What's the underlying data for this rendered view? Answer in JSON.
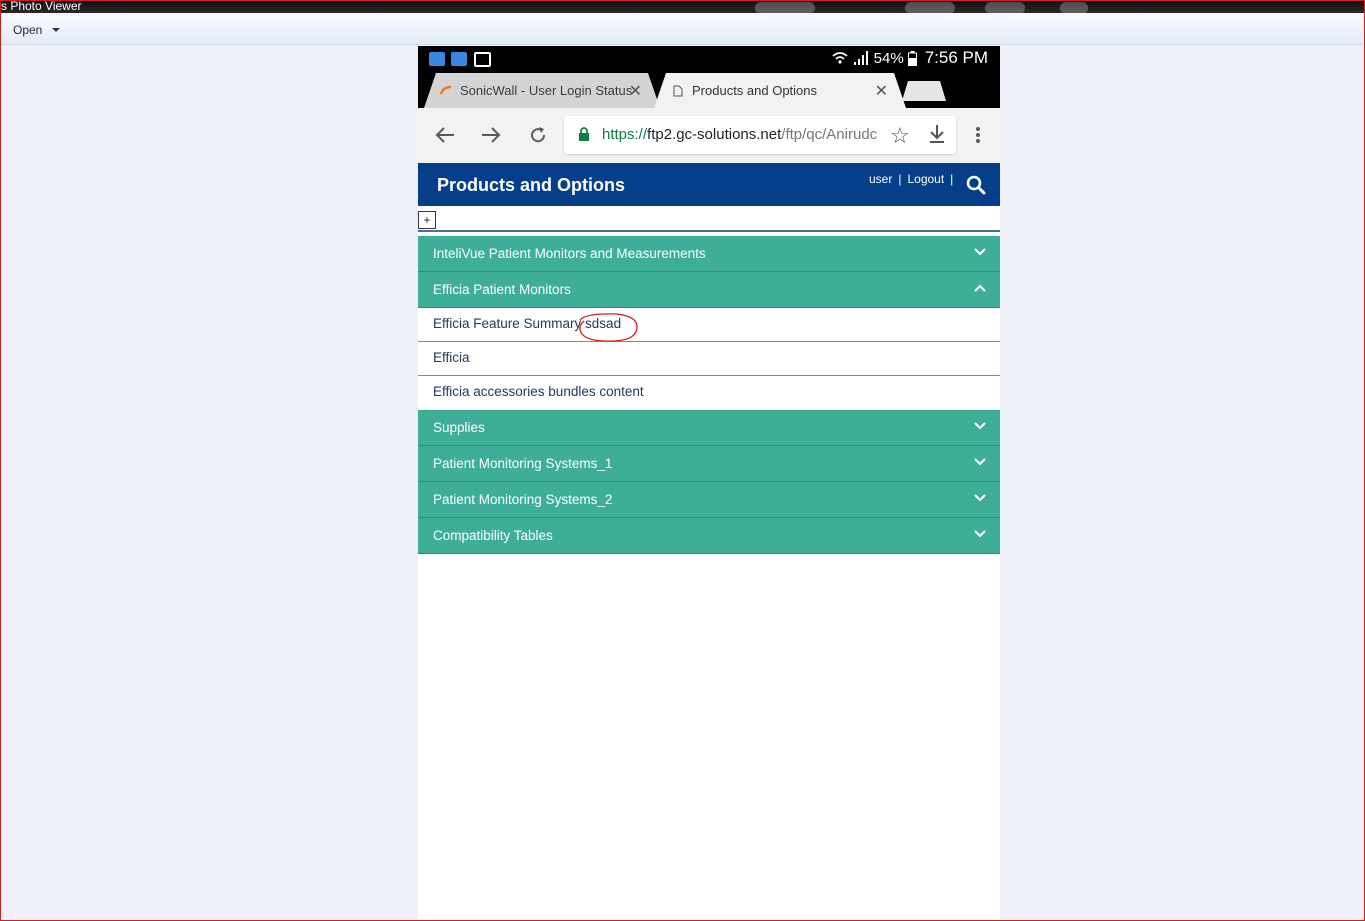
{
  "window": {
    "title": "s Photo Viewer",
    "open_label": "Open"
  },
  "status_bar": {
    "battery": "54%",
    "time": "7:56 PM"
  },
  "tabs": [
    {
      "label": "SonicWall - User Login Status",
      "active": false
    },
    {
      "label": "Products and Options",
      "active": true
    }
  ],
  "address": {
    "scheme": "https://",
    "host": "ftp2.gc-solutions.net",
    "path": "/ftp/qc/Anirudc"
  },
  "site": {
    "title": "Products and Options",
    "user_label": "user",
    "separator": "|",
    "logout_label": "Logout",
    "expand_label": "+"
  },
  "accordion": {
    "sections": [
      {
        "label": "InteliVue Patient Monitors and Measurements",
        "expanded": false
      },
      {
        "label": "Efficia Patient Monitors",
        "expanded": true
      },
      {
        "label": "Supplies",
        "expanded": false
      },
      {
        "label": "Patient Monitoring Systems_1",
        "expanded": false
      },
      {
        "label": "Patient Monitoring Systems_2",
        "expanded": false
      },
      {
        "label": "Compatibility Tables",
        "expanded": false
      }
    ],
    "efficia_items": [
      {
        "label": "Efficia Feature Summary sdsad"
      },
      {
        "label": "Efficia"
      },
      {
        "label": "Efficia accessories bundles content"
      }
    ]
  },
  "colors": {
    "header_blue": "#053f8a",
    "accordion_teal": "#3fae98",
    "annotation_red": "#d0201f"
  }
}
